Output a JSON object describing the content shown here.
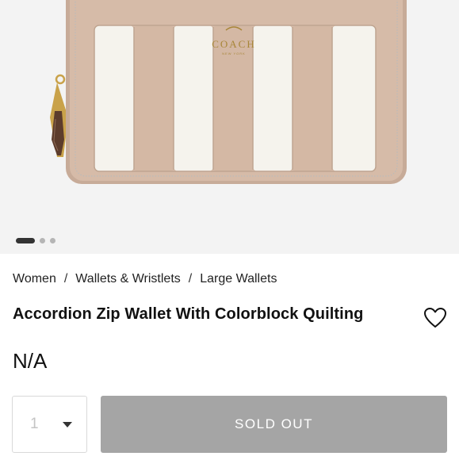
{
  "breadcrumb": {
    "items": [
      "Women",
      "Wallets & Wristlets",
      "Large Wallets"
    ],
    "separator": "/"
  },
  "product": {
    "title": "Accordion Zip Wallet With Colorblock Quilting",
    "price": "N/A",
    "image_logo_text": "COACH",
    "image_logo_subtext": "NEW YORK"
  },
  "gallery": {
    "total_images": 3,
    "active_index": 0
  },
  "quantity": {
    "value": "1"
  },
  "buttons": {
    "sold_out": "SOLD OUT"
  },
  "icons": {
    "wishlist": "heart-outline-icon",
    "quantity_toggle": "caret-down-icon"
  },
  "colors": {
    "button_disabled": "#a5a5a5",
    "wallet_tan": "#d4b8a4",
    "wallet_cream": "#f5f3ed",
    "hardware_gold": "#c9a24a"
  }
}
